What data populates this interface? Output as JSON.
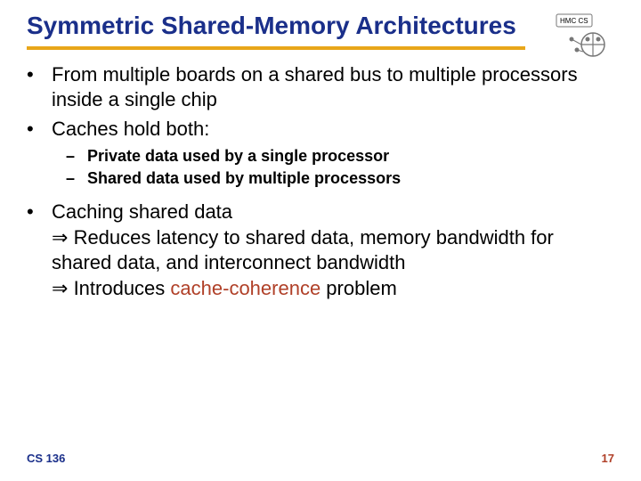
{
  "title": "Symmetric Shared-Memory Architectures",
  "logo_label": "HMC CS",
  "bullets": {
    "b1": "From multiple boards on a shared bus to multiple processors inside a single chip",
    "b2": "Caches hold both:",
    "b2a": "Private data used by a single processor",
    "b2b": "Shared data used by multiple processors",
    "b3": "Caching shared data",
    "b3_sub1_pre": "Reduces latency to shared data, memory bandwidth for shared data, and interconnect bandwidth",
    "b3_sub2_pre": "Introduces ",
    "b3_sub2_term": "cache-coherence",
    "b3_sub2_post": " problem"
  },
  "footer": {
    "course": "CS 136",
    "page": "17"
  }
}
